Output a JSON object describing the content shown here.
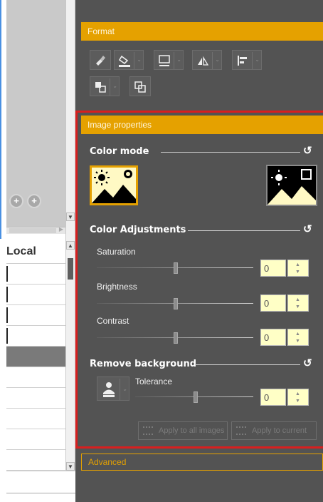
{
  "format": {
    "title": "Format",
    "toolbar": [
      {
        "icon": "format-painter-icon",
        "dropdown": false
      },
      {
        "icon": "fill-color-icon",
        "dropdown": true
      },
      {
        "icon": "border-style-icon",
        "dropdown": true
      },
      {
        "icon": "rotate-flip-icon",
        "dropdown": true
      },
      {
        "icon": "align-left-icon",
        "dropdown": true
      },
      {
        "icon": "arrange-order-icon",
        "dropdown": true
      },
      {
        "icon": "group-objects-icon",
        "dropdown": false
      }
    ]
  },
  "image_properties": {
    "title": "Image properties",
    "color_mode": {
      "label": "Color mode",
      "options": [
        "color-mode-normal",
        "color-mode-inverted"
      ],
      "selected": 0
    },
    "color_adjustments": {
      "label": "Color Adjustments",
      "saturation": {
        "label": "Saturation",
        "value": "0",
        "level": 0.5
      },
      "brightness": {
        "label": "Brightness",
        "value": "0",
        "level": 0.5
      },
      "contrast": {
        "label": "Contrast",
        "value": "0",
        "level": 0.5
      }
    },
    "remove_background": {
      "label": "Remove background",
      "tolerance": {
        "label": "Tolerance",
        "value": "0",
        "level": 0.5
      }
    },
    "apply_all_label": "Apply to all images",
    "apply_current_label": "Apply to current"
  },
  "advanced": {
    "title": "Advanced"
  },
  "table": {
    "column_header": "Local"
  },
  "colors": {
    "accent": "#e5a100",
    "panel_bg": "#535353",
    "highlight_border": "#d81f1f",
    "spin_bg": "#ffffc6"
  }
}
